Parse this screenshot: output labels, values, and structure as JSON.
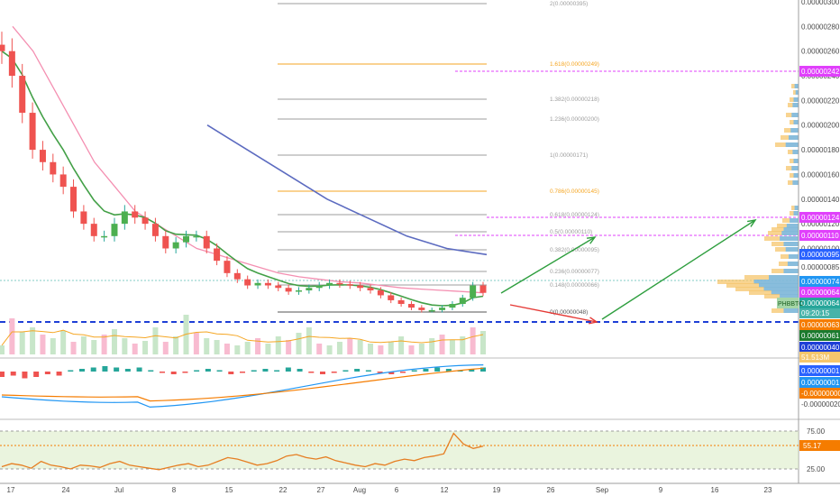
{
  "chart_data": {
    "type": "candlestick",
    "instrument_label": "PHBBTC",
    "countdown": "09:20:15",
    "x_ticks": [
      "17",
      "24",
      "Jul",
      "8",
      "15",
      "22",
      "27",
      "Aug",
      "6",
      "12",
      "19",
      "26",
      "Sep",
      "9",
      "16",
      "23"
    ],
    "y_ticks": [
      "0.00000300",
      "0.00000280",
      "0.00000260",
      "0.00000240",
      "0.00000220",
      "0.00000200",
      "0.00000180",
      "0.00000160",
      "0.00000140",
      "0.00000120",
      "0.00000100",
      "0.00000085"
    ],
    "ylim": [
      3e-07,
      3e-06
    ],
    "price_axis_labels": [
      {
        "text": "0.00000242",
        "color": "#e040fb"
      },
      {
        "text": "0.00000124",
        "color": "#e040fb"
      },
      {
        "text": "0.00000110",
        "color": "#e040fb"
      },
      {
        "text": "0.00000095",
        "color": "#2962ff"
      },
      {
        "text": "0.00000074",
        "color": "#2196f3"
      },
      {
        "text": "0.00000064",
        "color": "#e040fb"
      },
      {
        "text": "0.00000064",
        "color": "#26a69a"
      },
      {
        "text": "0.00000063",
        "color": "#f57c00"
      },
      {
        "text": "0.00000061",
        "color": "#1b7a2e"
      },
      {
        "text": "0.00000040",
        "color": "#1e3fd6"
      },
      {
        "text": "51.513M",
        "color": "#f5c66c"
      }
    ],
    "fib_levels": [
      {
        "ratio": "2",
        "price": "0.00000395",
        "color": "#9e9e9e"
      },
      {
        "ratio": "1.618",
        "price": "0.00000249",
        "color": "#f5a623"
      },
      {
        "ratio": "1.382",
        "price": "0.00000218",
        "color": "#9e9e9e"
      },
      {
        "ratio": "1.236",
        "price": "0.00000200",
        "color": "#9e9e9e"
      },
      {
        "ratio": "1",
        "price": "0.00000171",
        "color": "#9e9e9e"
      },
      {
        "ratio": "0.786",
        "price": "0.00000145",
        "color": "#f5a623"
      },
      {
        "ratio": "0.618",
        "price": "0.00000124",
        "color": "#9e9e9e"
      },
      {
        "ratio": "0.5",
        "price": "0.00000110",
        "color": "#9e9e9e"
      },
      {
        "ratio": "0.382",
        "price": "0.00000095",
        "color": "#9e9e9e"
      },
      {
        "ratio": "0.236",
        "price": "0.00000077",
        "color": "#9e9e9e"
      },
      {
        "ratio": "0.148",
        "price": "0.00000066",
        "color": "#9e9e9e"
      },
      {
        "ratio": "0",
        "price": "0.00000048",
        "color": "#555555"
      }
    ],
    "series": [
      {
        "name": "price",
        "color_up": "#26a69a",
        "color_down": "#ef5350",
        "values": [
          2.6e-06,
          2.4e-06,
          2.1e-06,
          1.8e-06,
          1.7e-06,
          1.6e-06,
          1.5e-06,
          1.3e-06,
          1.2e-06,
          1.1e-06,
          1.1e-06,
          1.2e-06,
          1.3e-06,
          1.25e-06,
          1.2e-06,
          1.1e-06,
          1e-06,
          1.05e-06,
          1.1e-06,
          1.1e-06,
          1e-06,
          9e-07,
          8e-07,
          7.5e-07,
          7e-07,
          7.2e-07,
          7e-07,
          6.8e-07,
          6.5e-07,
          6.6e-07,
          6.8e-07,
          7e-07,
          7.2e-07,
          7.1e-07,
          7e-07,
          6.8e-07,
          6.6e-07,
          6.2e-07,
          5.8e-07,
          5.5e-07,
          5.2e-07,
          5e-07,
          5e-07,
          5.2e-07,
          5.5e-07,
          6e-07,
          7e-07,
          6.4e-07
        ]
      },
      {
        "name": "",
        "values": [
          2.8e-06,
          2.6e-06,
          2.3e-06,
          2e-06,
          1.7e-06,
          1.5e-06,
          1.3e-06,
          1.2e-06,
          1.1e-06,
          1e-06,
          9.5e-07,
          9e-07,
          8.5e-07,
          8e-07,
          7.7e-07,
          7.5e-07,
          7.3e-07,
          7.2e-07,
          7e-07,
          6.8e-07,
          6.7e-07,
          6.6e-07,
          6.5e-07,
          6.4e-07
        ]
      },
      {
        "name": "",
        "values": [
          2e-06,
          1.8e-06,
          1.6e-06,
          1.4e-06,
          1.25e-06,
          1.1e-06,
          1e-06,
          9.5e-07
        ]
      }
    ],
    "macd_axis_labels": [
      {
        "text": "0.00000001",
        "color": "#2962ff"
      },
      {
        "text": "0.00000001",
        "color": "#2196f3"
      },
      {
        "text": "-0.00000000",
        "color": "#f57c00"
      },
      {
        "text": "-0.00000020",
        "color": "#4a4a4a"
      }
    ],
    "rsi": {
      "value": "55.17",
      "upper": "75.00",
      "lower": "25.00",
      "values": [
        28,
        32,
        30,
        26,
        35,
        30,
        28,
        25,
        30,
        29,
        27,
        32,
        35,
        30,
        28,
        26,
        24,
        27,
        30,
        32,
        28,
        30,
        35,
        40,
        38,
        34,
        30,
        32,
        36,
        42,
        44,
        40,
        38,
        41,
        36,
        33,
        30,
        28,
        32,
        30,
        35,
        38,
        36,
        40,
        42,
        45,
        72,
        58,
        52,
        55
      ]
    }
  }
}
